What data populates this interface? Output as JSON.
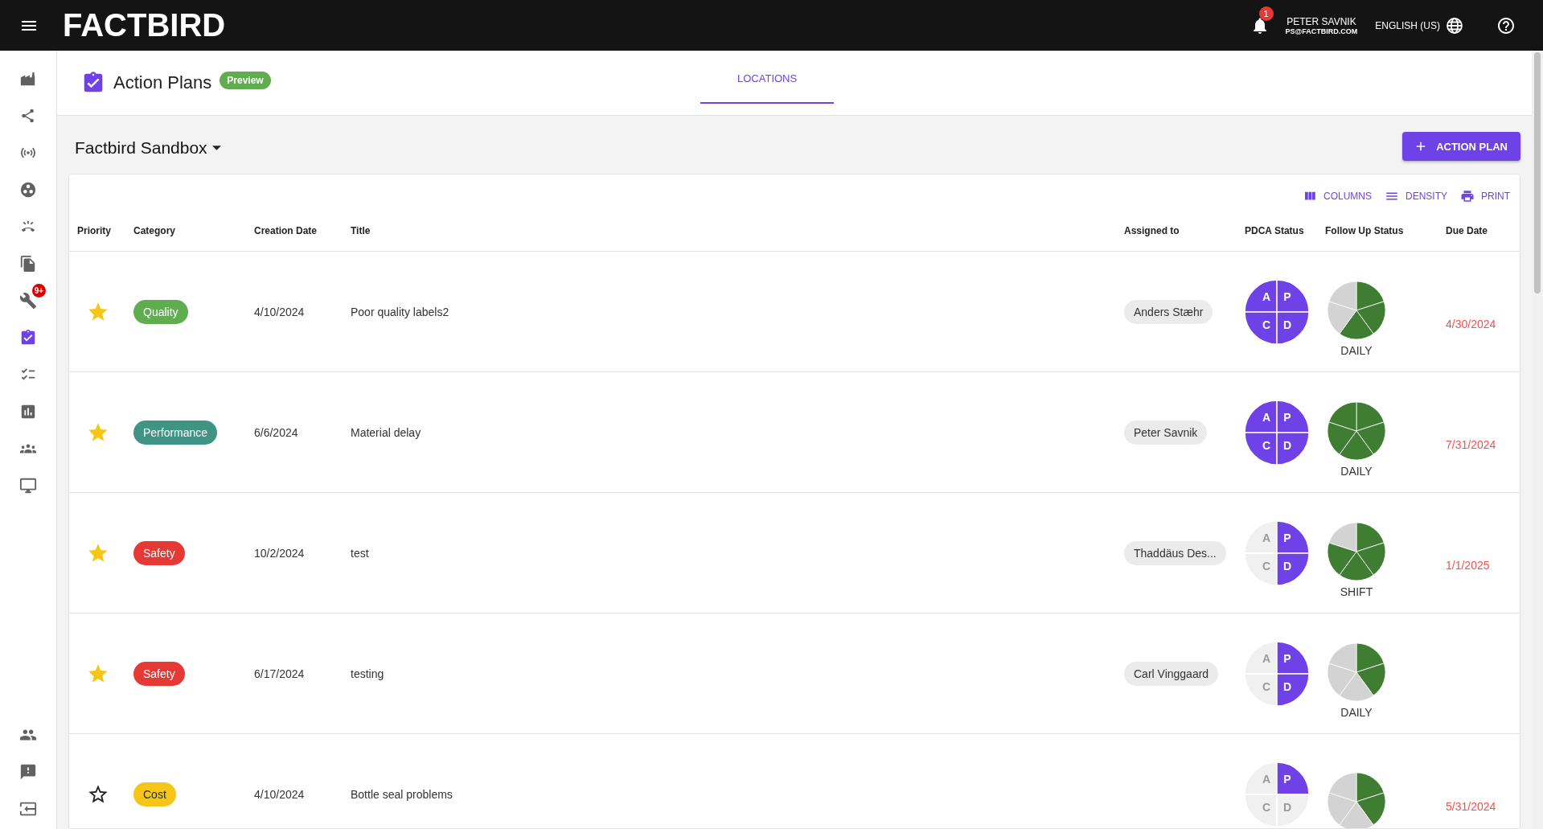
{
  "topbar": {
    "logo": "FACTBIRD",
    "notifications": {
      "count": "1"
    },
    "user": {
      "name": "PETER SAVNIK",
      "email": "PS@FACTBIRD.COM"
    },
    "language": "ENGLISH (US)"
  },
  "sidebar": {
    "items": [
      {
        "selected": false
      },
      {
        "selected": false
      },
      {
        "selected": false
      },
      {
        "selected": false
      },
      {
        "selected": false
      },
      {
        "selected": false
      },
      {
        "selected": false,
        "badge": "9+"
      },
      {
        "selected": true
      },
      {
        "selected": false
      },
      {
        "selected": false
      },
      {
        "selected": false
      },
      {
        "selected": false
      }
    ],
    "bottom_items": [
      {
        "selected": false
      },
      {
        "selected": false
      },
      {
        "selected": false
      }
    ]
  },
  "page_header": {
    "title": "Action Plans",
    "badge": "Preview",
    "tabs": [
      {
        "label": "LOCATIONS",
        "selected": true
      }
    ]
  },
  "location": "Factbird Sandbox",
  "add_button": "ACTION PLAN",
  "toolbar": [
    "COLUMNS",
    "DENSITY",
    "PRINT"
  ],
  "table": {
    "columns": [
      "Priority",
      "Category",
      "Creation Date",
      "Title",
      "Assigned to",
      "PDCA Status",
      "Follow Up Status",
      "Due Date"
    ],
    "rows": [
      {
        "starred": true,
        "category": {
          "label": "Quality",
          "color": "#5fad4e"
        },
        "created": "4/10/2024",
        "title": "Poor quality labels2",
        "assignee": "Anders Stæhr",
        "pdca": [
          {
            "letter": "A",
            "done": true
          },
          {
            "letter": "P",
            "done": true
          },
          {
            "letter": "C",
            "done": true
          },
          {
            "letter": "D",
            "done": true
          }
        ],
        "follow_up": {
          "segments": [
            {
              "done": true
            },
            {
              "done": true
            },
            {
              "done": true
            },
            {
              "done": false
            },
            {
              "done": false
            }
          ],
          "label": "DAILY"
        },
        "due": "4/30/2024"
      },
      {
        "starred": true,
        "category": {
          "label": "Performance",
          "color": "#3f9483"
        },
        "created": "6/6/2024",
        "title": "Material delay",
        "assignee": "Peter Savnik",
        "pdca": [
          {
            "letter": "A",
            "done": true
          },
          {
            "letter": "P",
            "done": true
          },
          {
            "letter": "C",
            "done": true
          },
          {
            "letter": "D",
            "done": true
          }
        ],
        "follow_up": {
          "segments": [
            {
              "done": true
            },
            {
              "done": true
            },
            {
              "done": true
            },
            {
              "done": true
            },
            {
              "done": true
            }
          ],
          "label": "DAILY"
        },
        "due": "7/31/2024"
      },
      {
        "starred": true,
        "category": {
          "label": "Safety",
          "color": "#e53935"
        },
        "created": "10/2/2024",
        "title": "test",
        "assignee": "Thaddäus Des...",
        "pdca": [
          {
            "letter": "A",
            "done": false
          },
          {
            "letter": "P",
            "done": true
          },
          {
            "letter": "C",
            "done": false
          },
          {
            "letter": "D",
            "done": true
          }
        ],
        "follow_up": {
          "segments": [
            {
              "done": true
            },
            {
              "done": true
            },
            {
              "done": true
            },
            {
              "done": true
            },
            {
              "done": false
            }
          ],
          "label": "SHIFT"
        },
        "due": "1/1/2025"
      },
      {
        "starred": true,
        "category": {
          "label": "Safety",
          "color": "#e53935"
        },
        "created": "6/17/2024",
        "title": "testing",
        "assignee": "Carl Vinggaard",
        "pdca": [
          {
            "letter": "A",
            "done": false
          },
          {
            "letter": "P",
            "done": true
          },
          {
            "letter": "C",
            "done": false
          },
          {
            "letter": "D",
            "done": true
          }
        ],
        "follow_up": {
          "segments": [
            {
              "done": true
            },
            {
              "done": true
            },
            {
              "done": false
            },
            {
              "done": false
            },
            {
              "done": false
            }
          ],
          "label": "DAILY"
        }
      },
      {
        "starred": false,
        "category": {
          "label": "Cost",
          "color": "#f5c518"
        },
        "created": "4/10/2024",
        "title": "Bottle seal problems",
        "pdca": [
          {
            "letter": "A",
            "done": false
          },
          {
            "letter": "P",
            "done": true
          },
          {
            "letter": "C",
            "done": false
          },
          {
            "letter": "D",
            "done": false
          }
        ],
        "follow_up": {
          "segments": [
            {
              "done": true
            },
            {
              "done": true
            },
            {
              "done": false
            },
            {
              "done": false
            },
            {
              "done": false
            }
          ]
        },
        "due": "5/31/2024"
      }
    ]
  }
}
